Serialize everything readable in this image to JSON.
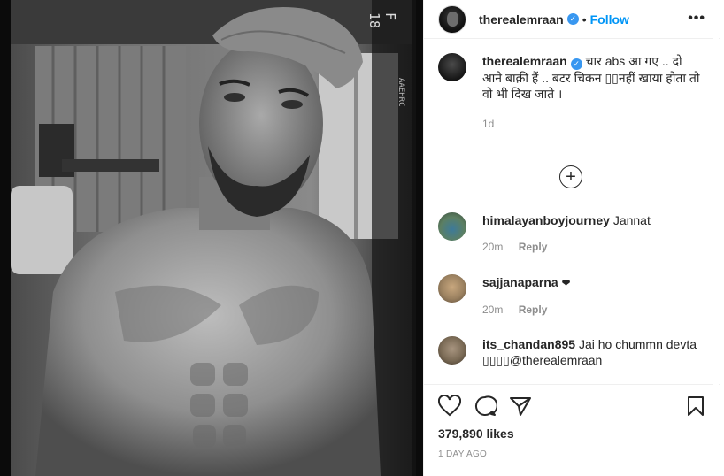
{
  "post": {
    "author": "therealemraan",
    "follow_label": "Follow",
    "separator": "•",
    "more_label": "•••",
    "verified_mark": "✓"
  },
  "caption": {
    "username": "therealemraan",
    "text": " चार abs आ गए .. दो आने बाक़ी हैं .. बटर चिकन ▯▯नहीं खाया होता तो वो भी दिख जाते ।",
    "time": "1d"
  },
  "comments": [
    {
      "username": "himalayanboyjourney",
      "text": "Jannat",
      "time": "20m",
      "reply_label": "Reply",
      "avatar_color": "#5c7f62"
    },
    {
      "username": "sajjanaparna",
      "text": "❤",
      "time": "20m",
      "reply_label": "Reply",
      "avatar_color": "#9b8160"
    },
    {
      "username": "its_chandan895",
      "text": "Jai ho chummn devta ▯▯▯▯@therealemraan",
      "time": "",
      "reply_label": "",
      "avatar_color": "#7a6a55"
    }
  ],
  "load_more_icon": "plus-circle-icon",
  "actions": {
    "icons": [
      "heart-icon",
      "comment-icon",
      "share-icon",
      "bookmark-icon"
    ],
    "likes": "379,890 likes",
    "posted": "1 DAY AGO"
  },
  "photo": {
    "film_edge_text": "F 18",
    "film_side_text": "AAEHRC"
  },
  "colors": {
    "accent": "#0095f6",
    "verified": "#3897f0",
    "meta": "#8e8e8e",
    "border": "#efefef"
  }
}
